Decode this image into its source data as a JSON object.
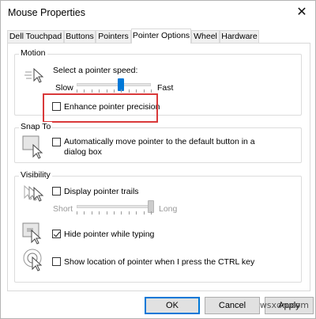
{
  "window": {
    "title": "Mouse Properties",
    "close_glyph": "✕"
  },
  "tabs": [
    {
      "label": "Dell Touchpad"
    },
    {
      "label": "Buttons"
    },
    {
      "label": "Pointers"
    },
    {
      "label": "Pointer Options",
      "active": true
    },
    {
      "label": "Wheel"
    },
    {
      "label": "Hardware"
    }
  ],
  "motion": {
    "group_label": "Motion",
    "speed_label": "Select a pointer speed:",
    "slow_label": "Slow",
    "fast_label": "Fast",
    "speed_value": 0.6,
    "enhance_label": "Enhance pointer precision",
    "enhance_checked": false
  },
  "snap_to": {
    "group_label": "Snap To",
    "line1": "Automatically move pointer to the default button in a",
    "line2": "dialog box",
    "checked": false
  },
  "visibility": {
    "group_label": "Visibility",
    "trails_label": "Display pointer trails",
    "trails_checked": false,
    "short_label": "Short",
    "long_label": "Long",
    "trails_value": 1.0,
    "hide_label": "Hide pointer while typing",
    "hide_checked": true,
    "ctrl_label": "Show location of pointer when I press the CTRL key",
    "ctrl_checked": false
  },
  "buttons": {
    "ok": "OK",
    "cancel": "Cancel",
    "apply": "Apply"
  },
  "watermark": "wsxdn.com",
  "colors": {
    "accent": "#0078d7",
    "highlight": "#d9393a",
    "thumb_active": "#0078d7",
    "thumb_disabled": "#cccccc"
  }
}
